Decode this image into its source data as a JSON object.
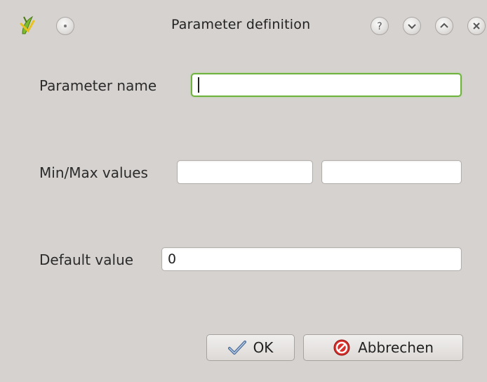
{
  "window": {
    "title": "Parameter definition"
  },
  "icons": {
    "app": "qgis-logo-icon",
    "menu": "window-menu-icon",
    "help": "help-icon",
    "minimize": "chevron-down-icon",
    "maximize": "chevron-up-icon",
    "close": "close-icon",
    "ok": "checkmark-icon",
    "cancel": "cancel-icon"
  },
  "form": {
    "parameter_name_label": "Parameter name",
    "parameter_name_value": "",
    "minmax_label": "Min/Max values",
    "min_value": "",
    "max_value": "",
    "default_label": "Default value",
    "default_value": "0"
  },
  "buttons": {
    "ok_label": "OK",
    "cancel_label": "Abbrechen"
  },
  "colors": {
    "background": "#d6d2d0",
    "focus_border": "#6fb33f",
    "cancel_icon": "#d9302c",
    "check_icon": "#4a6d9a"
  }
}
